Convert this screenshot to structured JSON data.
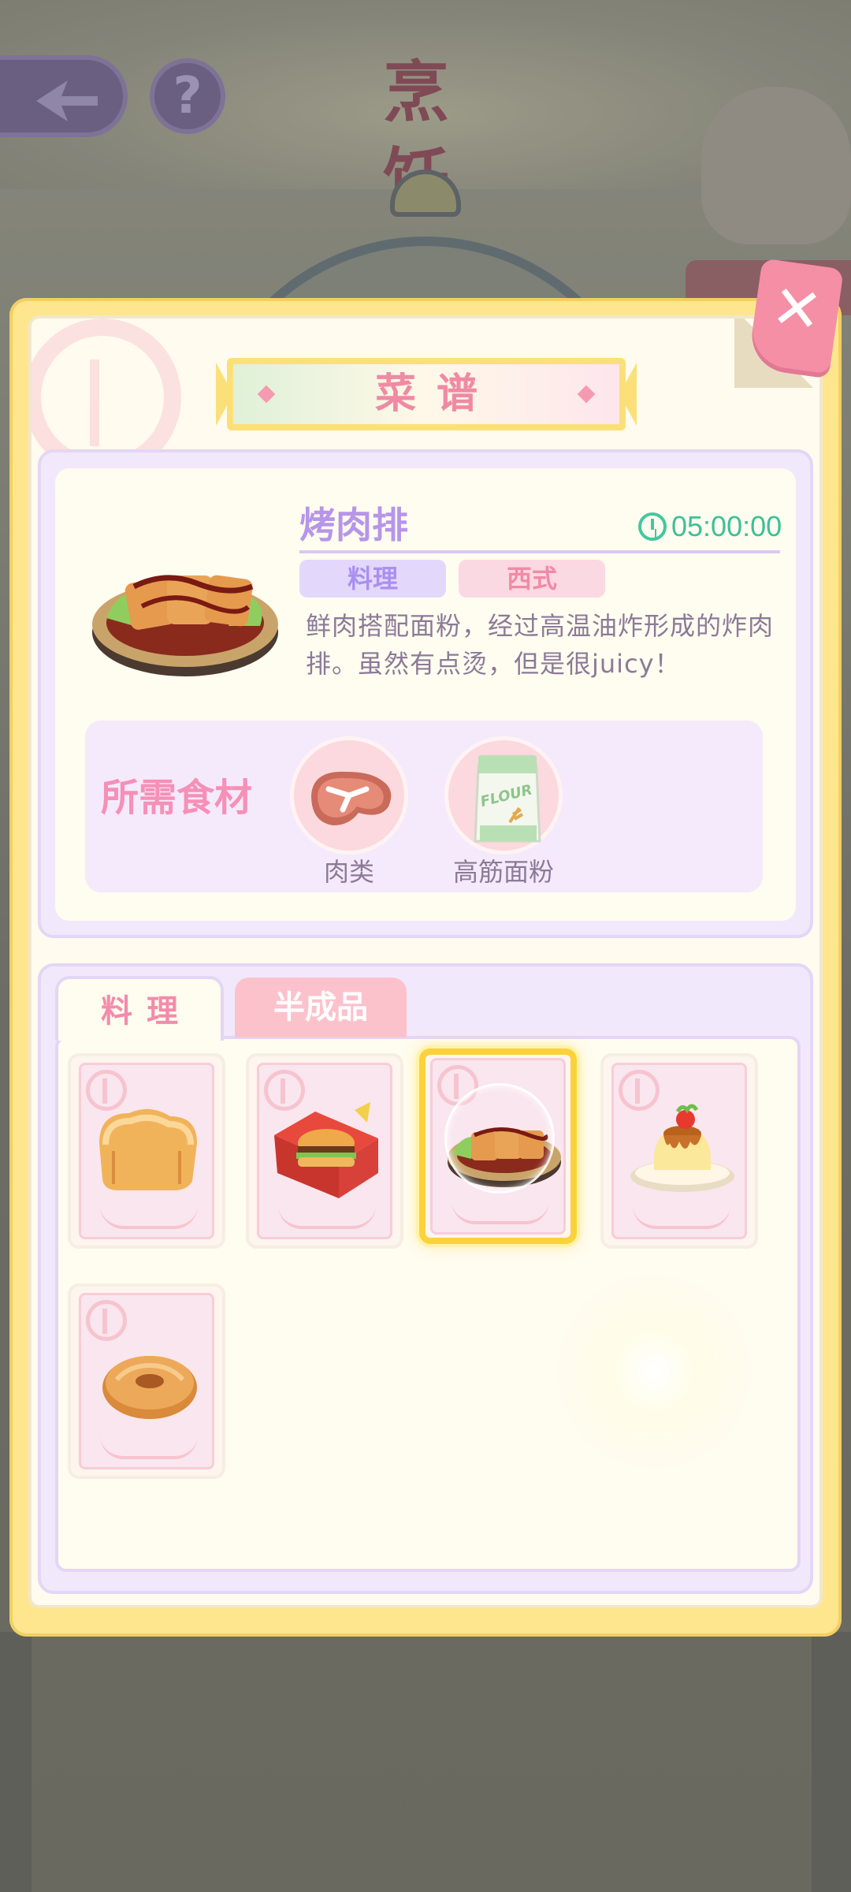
{
  "background": {
    "title": "烹 饪",
    "help_label": "?"
  },
  "panel": {
    "title": "菜谱",
    "close_label": "✕"
  },
  "detail": {
    "dish_name": "烤肉排",
    "timer": "05:00:00",
    "tags": [
      "料理",
      "西式"
    ],
    "description": "鲜肉搭配面粉，经过高温油炸形成的炸肉排。虽然有点烫，但是很juicy！",
    "ingredients_label": "所需食材",
    "ingredients": [
      {
        "name": "肉类",
        "icon": "steak-icon"
      },
      {
        "name": "高筋面粉",
        "icon": "flour-bag-icon"
      }
    ]
  },
  "tabs": [
    {
      "label": "料理",
      "active": true
    },
    {
      "label": "半成品",
      "active": false
    }
  ],
  "recipes": [
    {
      "icon": "bread-loaf-icon",
      "selected": false
    },
    {
      "icon": "burger-box-icon",
      "selected": false
    },
    {
      "icon": "cutlet-plate-icon",
      "selected": true
    },
    {
      "icon": "pudding-icon",
      "selected": false
    },
    {
      "icon": "donut-icon",
      "selected": false
    }
  ],
  "colors": {
    "panel_border": "#fde68e",
    "accent_pink": "#f08aa4",
    "accent_purple": "#b795ea",
    "timer_green": "#3fbf98",
    "selected_gold": "#fbd23c"
  }
}
